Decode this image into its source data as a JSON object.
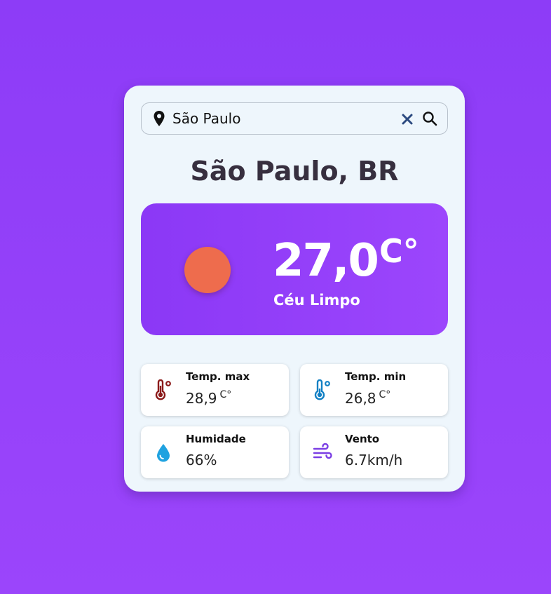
{
  "search": {
    "value": "São Paulo",
    "icons": {
      "location": "map-pin-icon",
      "clear": "close-icon",
      "submit": "search-icon"
    }
  },
  "location_title": "São Paulo, BR",
  "current": {
    "temperature": "27,0",
    "unit": "C°",
    "condition": "Céu Limpo",
    "weather_icon": "sun-icon"
  },
  "details": {
    "max": {
      "label": "Temp. max",
      "value": "28,9",
      "unit": "C°",
      "icon": "thermometer-hot-icon"
    },
    "min": {
      "label": "Temp. min",
      "value": "26,8",
      "unit": "C°",
      "icon": "thermometer-cold-icon"
    },
    "humidity": {
      "label": "Humidade",
      "value": "66%",
      "icon": "water-drop-icon"
    },
    "wind": {
      "label": "Vento",
      "value": "6.7km/h",
      "icon": "wind-icon"
    }
  },
  "colors": {
    "background": "#8d3cf7",
    "card": "#eef6fc",
    "hero_start": "#8b38f6",
    "hero_end": "#9c46fc",
    "sun": "#ee6c4d",
    "max_icon": "#8b1a1a",
    "min_icon": "#1280c4",
    "humidity_icon": "#1fa2e0",
    "wind_icon": "#7b3fe4",
    "clear_icon": "#2c4a80"
  }
}
